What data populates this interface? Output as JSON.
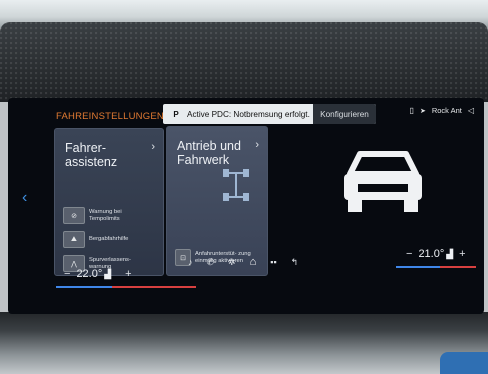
{
  "header": {
    "section_title": "FAHREINSTELLUNGEN",
    "notification_text": "Active PDC: Notbremsung erfolgt.",
    "notification_button": "Konfigurieren",
    "notification_icon": "P",
    "status_text": "Rock Ant"
  },
  "cards": [
    {
      "title_line1": "Fahrer-",
      "title_line2": "assistenz",
      "items": [
        {
          "label": "Warnung bei Tempolimits",
          "icon": "speed-limit-icon"
        },
        {
          "label": "Bergabfahrhilfe",
          "icon": "hill-descent-icon"
        },
        {
          "label": "Spurverlassens- warnung",
          "icon": "lane-departure-icon"
        }
      ]
    },
    {
      "title_line1": "Antrieb und",
      "title_line2": "Fahrwerk",
      "items": [
        {
          "label": "Anfahrunterstüt- zung einmalig aktivieren",
          "icon": "start-assist-icon"
        }
      ]
    }
  ],
  "climate": {
    "left_temp": "22.0°",
    "right_temp": "21.0°",
    "minus": "−",
    "plus": "+"
  },
  "colors": {
    "accent_orange": "#e07a32",
    "accent_blue": "#3f8fe0",
    "screen_bg": "#070a10"
  }
}
